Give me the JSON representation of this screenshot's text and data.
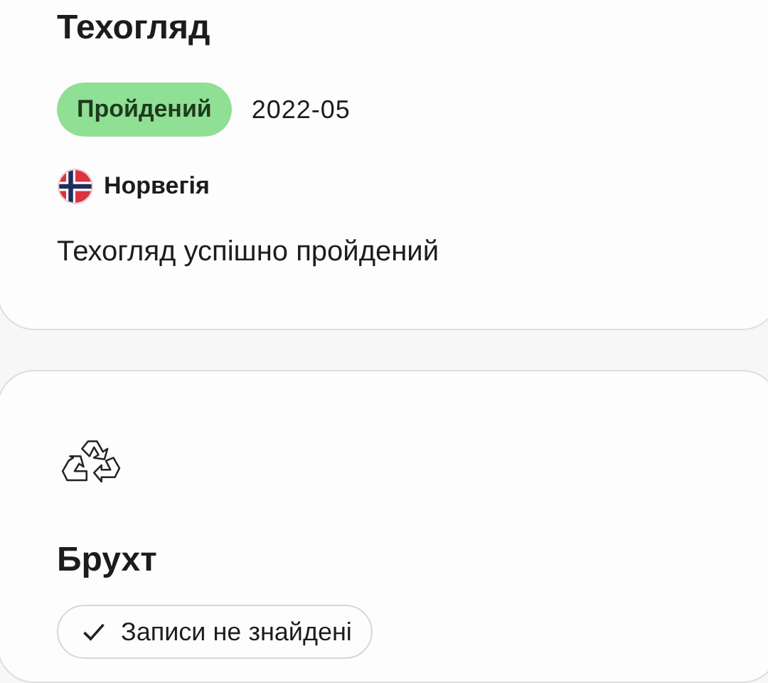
{
  "cards": [
    {
      "kind": "inspection",
      "title": "Техогляд",
      "status": {
        "label": "Пройдений",
        "kind": "passed"
      },
      "date": "2022-05",
      "country": "Норвегія",
      "description": "Техогляд успішно пройдений"
    },
    {
      "kind": "scrap",
      "title": "Брухт",
      "result": {
        "label": "Записи не знайдені",
        "checked": true
      }
    }
  ]
}
